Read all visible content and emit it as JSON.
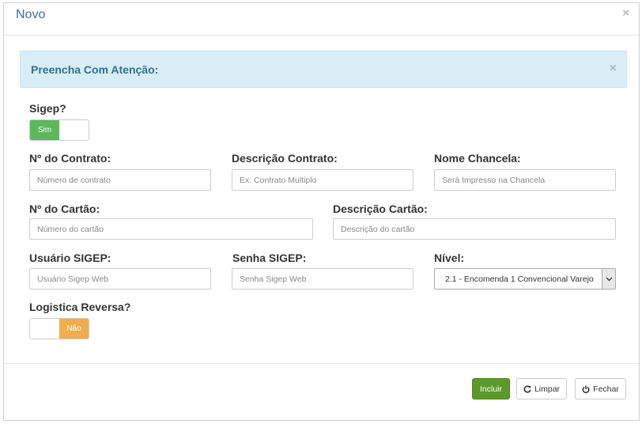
{
  "modal": {
    "title": "Novo",
    "close_glyph": "×"
  },
  "alert": {
    "text": "Preencha Com Atenção:",
    "close_glyph": "×"
  },
  "sigep": {
    "label": "Sigep?",
    "toggle_state": "Sim",
    "toggle_color": "#5cb85c"
  },
  "fields": {
    "contrato": {
      "label": "Nº do Contrato:",
      "placeholder": "Número de contrato",
      "value": ""
    },
    "descricao_contrato": {
      "label": "Descrição Contrato:",
      "placeholder": "Ex: Contrato Multiplo",
      "value": ""
    },
    "nome_chancela": {
      "label": "Nome Chancela:",
      "placeholder": "Será Impresso na Chancela",
      "value": ""
    },
    "cartao": {
      "label": "Nº do Cartão:",
      "placeholder": "Número do cartão",
      "value": ""
    },
    "descricao_cartao": {
      "label": "Descrição Cartão:",
      "placeholder": "Descrição do cartão",
      "value": ""
    },
    "usuario_sigep": {
      "label": "Usuário SIGEP:",
      "placeholder": "Usuário Sigep Web",
      "value": ""
    },
    "senha_sigep": {
      "label": "Senha SIGEP:",
      "placeholder": "Senha Sigep Web",
      "value": ""
    },
    "nivel": {
      "label": "Nível:",
      "selected": "2.1 - Encomenda 1 Convencional Varejo"
    }
  },
  "logistica": {
    "label": "Logistica Reversa?",
    "toggle_state": "Não",
    "toggle_color": "#f0ad4e"
  },
  "footer": {
    "incluir_label": "Incluir",
    "limpar_label": "Limpar",
    "fechar_label": "Fechar",
    "incluir_color": "#5b9a2a"
  }
}
